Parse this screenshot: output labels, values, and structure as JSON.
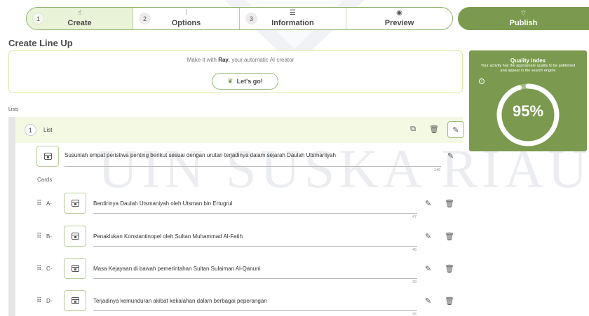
{
  "stepper": {
    "steps": [
      {
        "num": "1",
        "label": "Create",
        "icon": "hand-pointer-icon"
      },
      {
        "num": "2",
        "label": "Options",
        "icon": "sliders-icon"
      },
      {
        "num": "3",
        "label": "Information",
        "icon": "list-icon"
      },
      {
        "num": "",
        "label": "Preview",
        "icon": "eye-icon"
      }
    ],
    "active_index": 0
  },
  "publish": {
    "label": "Publish",
    "icon": "broadcast-icon"
  },
  "page_title": "Create Line Up",
  "ray": {
    "text_prefix": "Make it with ",
    "brand": "Ray",
    "text_suffix": ", your automatic AI creator",
    "button_label": "Let's go!",
    "button_icon": "leaf-icon"
  },
  "quality": {
    "title": "Quality index",
    "description": "Your activity has the appropriate quality to be published and appear in the search engine",
    "value_text": "95%",
    "value": 0.95,
    "info_icon": "info-icon"
  },
  "lists_label": "Lists",
  "list": {
    "num": "1",
    "name": "List",
    "question": {
      "text": "Susunlah empat peristiwa penting berikut sesuai dengan urutan terjadinya dalam sejarah Daulah Utsmaniyah",
      "count": "146"
    },
    "cards_label": "Cards",
    "cards": [
      {
        "letter": "A-",
        "text": "Berdirinya Daulah Utsmaniyah oleh Utsman bin Ertugrul",
        "count": "47"
      },
      {
        "letter": "B-",
        "text": "Penaklukan Konstantinopel oleh Sultan Muhammad Al-Fatih",
        "count": "45"
      },
      {
        "letter": "C-",
        "text": "Masa Kejayaan di bawah pemerintahan Sultan Sulaiman Al-Qanuni",
        "count": "39"
      },
      {
        "letter": "D-",
        "text": "Terjadinya kemunduran akibat kekalahan dalam berbagai peperangan",
        "count": "36"
      }
    ]
  },
  "watermark": "UIN SUSKA RIAU",
  "colors": {
    "accent": "#7b9a4f",
    "active_step": "#e9f3d8",
    "list_header": "#f4f9e4",
    "ray_border": "#dfe8a8"
  }
}
